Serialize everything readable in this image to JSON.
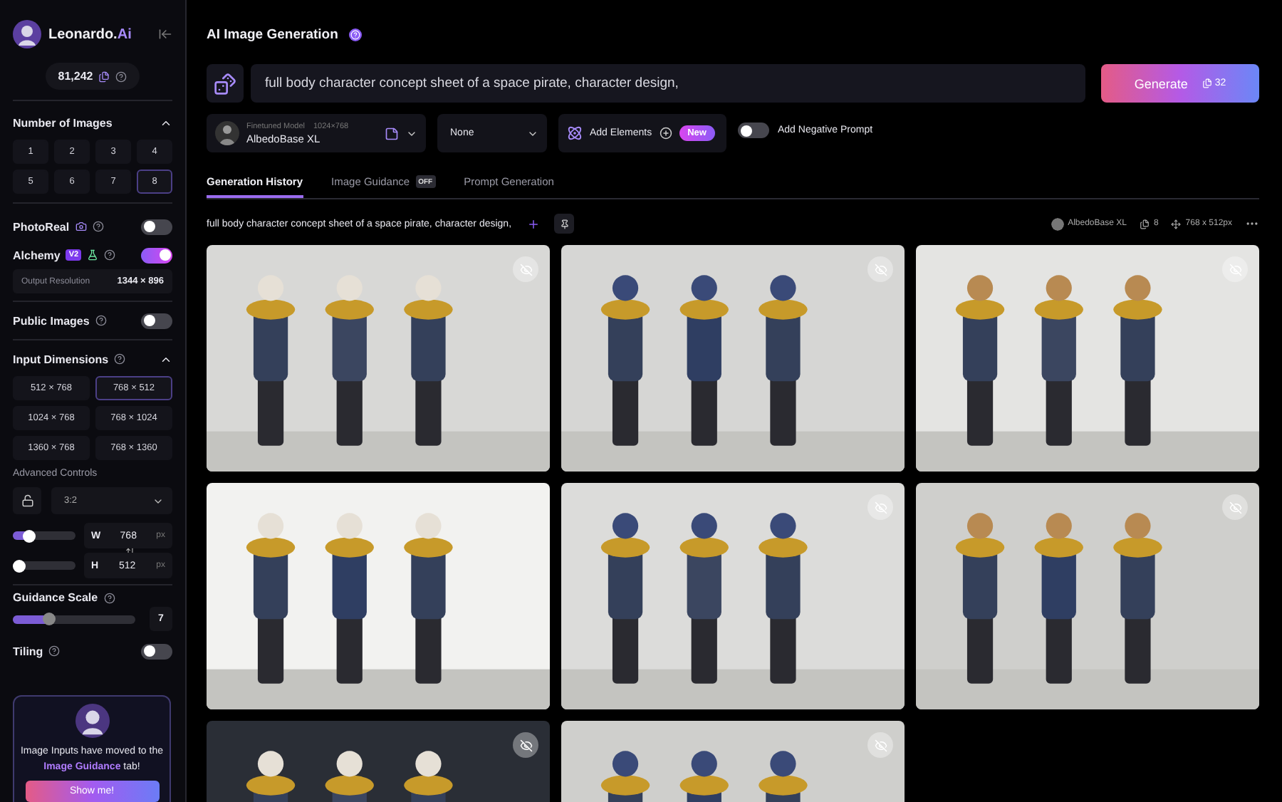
{
  "sidebar": {
    "brand": {
      "name": "Leonardo.",
      "accent": "Ai"
    },
    "credits": "81,242",
    "number_of_images": {
      "title": "Number of Images",
      "expanded": true,
      "options": [
        {
          "label": "1",
          "selected": false
        },
        {
          "label": "2",
          "selected": false
        },
        {
          "label": "3",
          "selected": false
        },
        {
          "label": "4",
          "selected": false
        },
        {
          "label": "5",
          "selected": false
        },
        {
          "label": "6",
          "selected": false
        },
        {
          "label": "7",
          "selected": false
        },
        {
          "label": "8",
          "selected": true
        }
      ]
    },
    "photoreal": {
      "label": "PhotoReal",
      "on": false
    },
    "alchemy": {
      "label": "Alchemy",
      "badge": "V2",
      "on": true,
      "output_label": "Output Resolution",
      "output_value": "1344 × 896"
    },
    "public_images": {
      "label": "Public Images",
      "on": false
    },
    "input_dimensions": {
      "title": "Input Dimensions",
      "expanded": true,
      "options": [
        {
          "label": "512 × 768",
          "selected": false
        },
        {
          "label": "768 × 512",
          "selected": true
        },
        {
          "label": "1024 × 768",
          "selected": false
        },
        {
          "label": "768 × 1024",
          "selected": false
        },
        {
          "label": "1360 × 768",
          "selected": false
        },
        {
          "label": "768 × 1360",
          "selected": false
        }
      ]
    },
    "advanced": {
      "title": "Advanced Controls",
      "ratio": "3:2",
      "width": {
        "label": "W",
        "value": "768",
        "unit": "px",
        "level": 0.25
      },
      "height": {
        "label": "H",
        "value": "512",
        "unit": "px",
        "level": 0.0
      }
    },
    "guidance": {
      "label": "Guidance Scale",
      "level": 0.3,
      "value": "7"
    },
    "tiling": {
      "label": "Tiling",
      "on": false
    },
    "notice": {
      "before": "Image Inputs have moved to the ",
      "link": "Image Guidance",
      "after": " tab!",
      "button": "Show me!"
    }
  },
  "header": {
    "title": "AI Image Generation"
  },
  "prompt": {
    "value": "full body character concept sheet of a space pirate, character design,",
    "generate": "Generate",
    "cost": "32"
  },
  "options": {
    "model_caption": "Finetuned Model",
    "model_size": "1024×768",
    "model": "AlbedoBase XL",
    "style": "None",
    "elements": "Add Elements",
    "elements_badge": "New",
    "negative": {
      "label": "Add Negative Prompt",
      "on": false
    }
  },
  "tabs": [
    {
      "label": "Generation History",
      "selected": true
    },
    {
      "label": "Image Guidance",
      "badge": "OFF",
      "selected": false
    },
    {
      "label": "Prompt Generation",
      "selected": false
    }
  ],
  "generation": {
    "prompt": "full body character concept sheet of a space pirate, character design,",
    "model": "AlbedoBase XL",
    "count": "8",
    "size": "768 x 512px",
    "images": [
      {
        "kind": "picture",
        "private": true
      },
      {
        "kind": "picture",
        "private": true
      },
      {
        "kind": "picture",
        "private": true
      },
      {
        "kind": "picture",
        "private": false
      },
      {
        "kind": "picture",
        "private": true
      },
      {
        "kind": "picture",
        "private": true
      },
      {
        "kind": "picture",
        "private": true
      },
      {
        "kind": "picture",
        "private": true
      }
    ]
  }
}
